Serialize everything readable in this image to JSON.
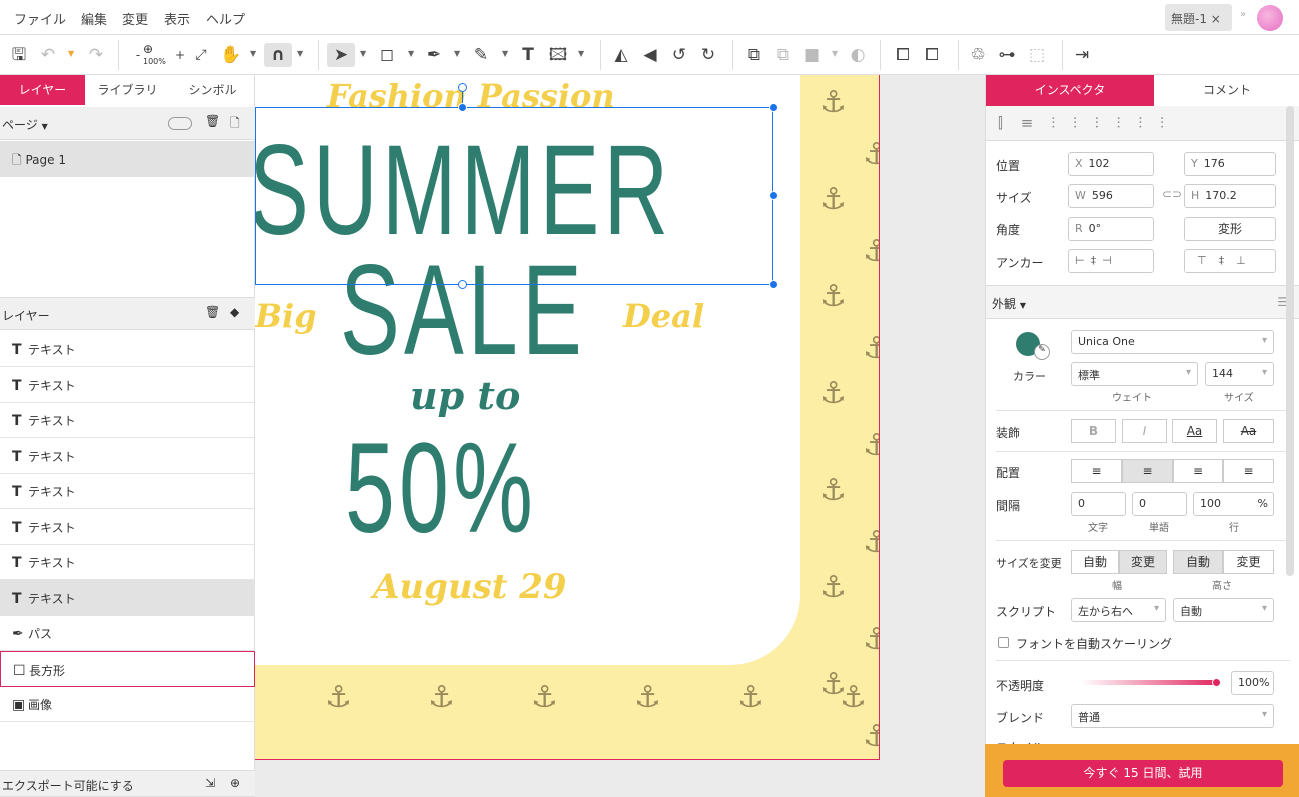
{
  "menu": [
    "ファイル",
    "編集",
    "変更",
    "表示",
    "ヘルプ"
  ],
  "document_tab": {
    "title": "無題-1",
    "close": "×"
  },
  "toolbar": {
    "zoom": "100%",
    "zoom_out": "-",
    "zoom_in": "+"
  },
  "left_panel": {
    "tabs": [
      "レイヤー",
      "ライブラリ",
      "シンボル"
    ],
    "pages_header": "ページ",
    "pages": [
      "Page 1"
    ],
    "layers_header": "レイヤー",
    "layers": [
      {
        "icon": "T",
        "label": "テキスト"
      },
      {
        "icon": "T",
        "label": "テキスト"
      },
      {
        "icon": "T",
        "label": "テキスト"
      },
      {
        "icon": "T",
        "label": "テキスト"
      },
      {
        "icon": "T",
        "label": "テキスト"
      },
      {
        "icon": "T",
        "label": "テキスト"
      },
      {
        "icon": "T",
        "label": "テキスト"
      },
      {
        "icon": "T",
        "label": "テキスト",
        "selected": true
      },
      {
        "icon": "pen",
        "label": "パス"
      },
      {
        "icon": "rect",
        "label": "長方形"
      },
      {
        "icon": "image",
        "label": "画像"
      }
    ],
    "export_label": "エクスポート可能にする"
  },
  "artwork": {
    "fashion": "Fashion Passion",
    "summer": "SUMMER",
    "sale": "SALE",
    "big": "Big",
    "deal": "Deal",
    "upto": "up to",
    "percent": "50%",
    "date": "August 29",
    "teal": "#2e7d6e",
    "yellow": "#f4cf4c"
  },
  "inspector": {
    "tabs": [
      "インスペクタ",
      "コメント"
    ],
    "position_label": "位置",
    "x": "102",
    "y": "176",
    "size_label": "サイズ",
    "w": "596",
    "h": "170.2",
    "angle_label": "角度",
    "r": "0°",
    "transform_button": "変形",
    "anchor_label": "アンカー",
    "appearance_label": "外観",
    "font": "Unica One",
    "color_label": "カラー",
    "weight": "標準",
    "weight_label": "ウェイト",
    "font_size": "144",
    "size_small_label": "サイズ",
    "decoration_label": "装飾",
    "deco": [
      "B",
      "I",
      "Aa",
      "Aa"
    ],
    "align_label": "配置",
    "spacing_label": "間隔",
    "char_spacing": "0",
    "word_spacing": "0",
    "line_spacing": "100",
    "percent": "%",
    "char_label": "文字",
    "word_label": "単語",
    "line_label": "行",
    "resize_label": "サイズを変更",
    "auto": "自動",
    "change": "変更",
    "width_label": "幅",
    "height_label": "高さ",
    "script_label": "スクリプト",
    "direction": "左から右へ",
    "script_auto": "自動",
    "autoscale_label": "フォントを自動スケーリング",
    "opacity_label": "不透明度",
    "opacity": "100%",
    "opacity_value": 1.0,
    "blend_label": "ブレンド",
    "blend": "普通",
    "style_label": "スタイル"
  },
  "trial_button": "今すぐ 15 日間、試用",
  "colors": {
    "accent": "#e0245e",
    "trial_bar": "#f2a633",
    "selection": "#1a73e8"
  }
}
